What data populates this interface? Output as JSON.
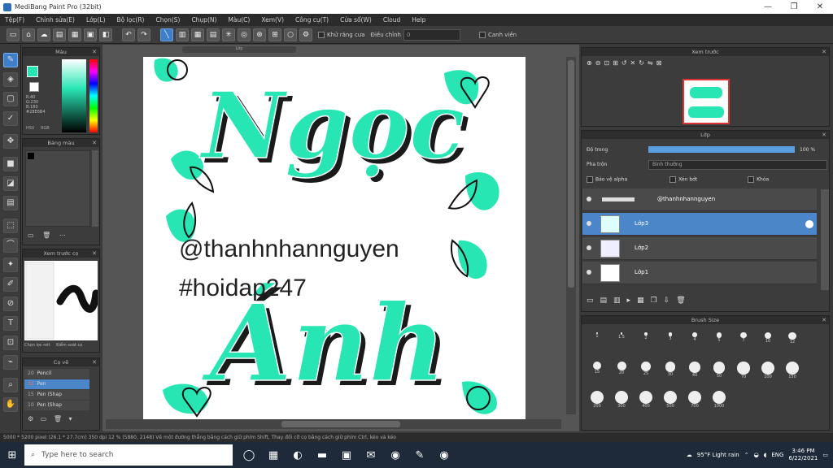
{
  "window": {
    "title": "MediBang Paint Pro (32bit)",
    "controls": [
      "—",
      "❐",
      "✕"
    ]
  },
  "menu": [
    "Tệp(F)",
    "Chỉnh sửa(E)",
    "Lớp(L)",
    "Bộ lọc(R)",
    "Chọn(S)",
    "Chụp(N)",
    "Màu(C)",
    "Xem(V)",
    "Công cụ(T)",
    "Cửa sổ(W)",
    "Cloud",
    "Help"
  ],
  "toolbar": {
    "antialias_label": "Khử răng cưa",
    "correction_label": "Điều chỉnh",
    "correction_value": "0",
    "canvas_label": "Canh viền"
  },
  "color_panel": {
    "title": "Màu",
    "hex_lines": [
      "R:40",
      "G:230",
      "B:180",
      "#28E6B4"
    ],
    "tabs": [
      "HSV",
      "RGB"
    ]
  },
  "palette_panel": {
    "title": "Bảng màu"
  },
  "navigator_panel": {
    "title": "Xem trước cọ",
    "tabs": [
      "Chọn lọc nét",
      "Kiểm soát cọ"
    ]
  },
  "brush_list_panel": {
    "title": "Cọ vẽ",
    "items": [
      {
        "size": "20",
        "name": "Pencil"
      },
      {
        "size": "32",
        "name": "Pen"
      },
      {
        "size": "15",
        "name": "Pen (Shap"
      },
      {
        "size": "10",
        "name": "Pen (Shap"
      }
    ]
  },
  "canvas": {
    "tab_label": "Lớp",
    "title_word1": "Ngọc",
    "title_word2": "Ánh",
    "handle": "@thanhnhannguyen",
    "hashtag": "#hoidap247"
  },
  "nav_preview_panel": {
    "title": "Xem trước"
  },
  "layer_panel": {
    "title": "Lớp",
    "opacity_label": "Độ trong",
    "opacity_value": "100 %",
    "opacity_fraction": 1.0,
    "blend_label": "Pha trộn",
    "blend_value": "Bình thường",
    "checks": [
      "Bảo vệ alpha",
      "Xén bớt",
      "Khóa"
    ],
    "layers": [
      {
        "name": "@thanhnhannguyen",
        "selected": false
      },
      {
        "name": "Lớp3",
        "selected": true
      },
      {
        "name": "Lớp2",
        "selected": false
      },
      {
        "name": "Lớp1",
        "selected": false
      }
    ]
  },
  "brush_size_panel": {
    "title": "Brush Size",
    "sizes": [
      "1",
      "1.5",
      "2",
      "3",
      "4",
      "5",
      "7",
      "10",
      "12",
      "15",
      "20",
      "25",
      "30",
      "40",
      "50",
      "70",
      "100",
      "150",
      "200",
      "300",
      "400",
      "500",
      "700",
      "1000"
    ]
  },
  "status": "5000 * 5200 pixel (26.1 * 27.7cm) 350 dpi 12 % (5880, 2148) Vẽ một đường thẳng bằng cách giữ phím Shift, Thay đổi cỡ cọ bằng cách giữ phím Ctrl, kéo và kéo",
  "taskbar": {
    "search_placeholder": "Type here to search",
    "weather": "95°F Light rain",
    "lang": "ENG",
    "time": "3:46 PM",
    "date": "6/22/2021"
  },
  "colors": {
    "accent_teal": "#28E6B4",
    "selection_blue": "#4a86c8"
  }
}
